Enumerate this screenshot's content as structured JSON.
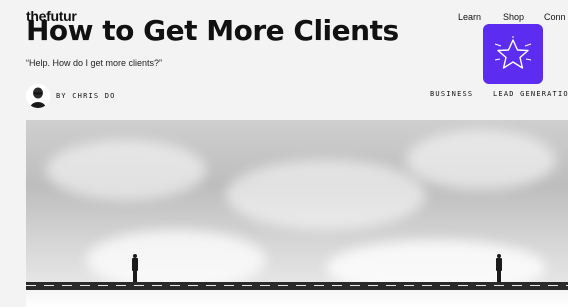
{
  "brand": {
    "name": "thefutur"
  },
  "nav": {
    "items": [
      {
        "label": "Learn"
      },
      {
        "label": "Shop"
      },
      {
        "label": "Conn"
      }
    ]
  },
  "article": {
    "title": "How to Get More Clients",
    "subtitle": "“Help. How do I get more clients?”",
    "byline": "BY CHRIS DO",
    "tags": [
      "BUSINESS",
      "LEAD GENERATIO"
    ]
  },
  "promo": {
    "icon": "star-icon",
    "color": "#5c2df0"
  },
  "colors": {
    "accent": "#5c2df0"
  }
}
